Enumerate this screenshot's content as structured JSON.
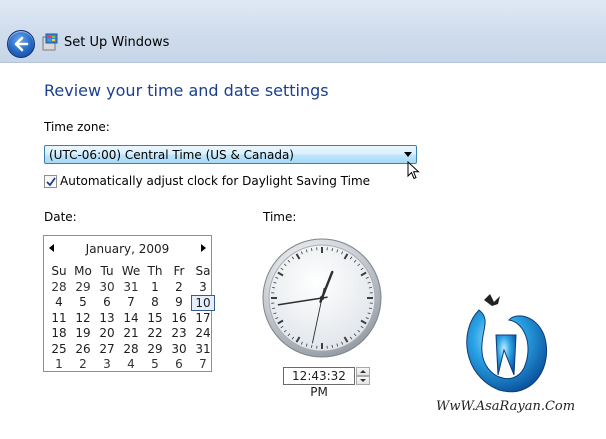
{
  "window": {
    "title": "Set Up Windows"
  },
  "page": {
    "heading": "Review your time and date settings"
  },
  "timezone": {
    "label": "Time zone:",
    "selected": "(UTC-06:00) Central Time (US & Canada)"
  },
  "dst": {
    "label": "Automatically adjust clock for Daylight Saving Time",
    "checked": true
  },
  "date": {
    "label": "Date:",
    "month_title": "January, 2009",
    "weekdays": [
      "Su",
      "Mo",
      "Tu",
      "We",
      "Th",
      "Fr",
      "Sa"
    ],
    "weeks": [
      [
        "28",
        "29",
        "30",
        "31",
        "1",
        "2",
        "3"
      ],
      [
        "4",
        "5",
        "6",
        "7",
        "8",
        "9",
        "10"
      ],
      [
        "11",
        "12",
        "13",
        "14",
        "15",
        "16",
        "17"
      ],
      [
        "18",
        "19",
        "20",
        "21",
        "22",
        "23",
        "24"
      ],
      [
        "25",
        "26",
        "27",
        "28",
        "29",
        "30",
        "31"
      ],
      [
        "1",
        "2",
        "3",
        "4",
        "5",
        "6",
        "7"
      ]
    ],
    "selected_day": "10"
  },
  "time": {
    "label": "Time:",
    "value": "12:43:32 PM",
    "hour": 12,
    "minute": 43,
    "second": 32
  },
  "watermark": {
    "text": "WwW.AsaRayan.Com"
  },
  "colors": {
    "heading": "#1a3f8e",
    "accent": "#3c7fb1",
    "titlebar": "#cfdcec"
  }
}
